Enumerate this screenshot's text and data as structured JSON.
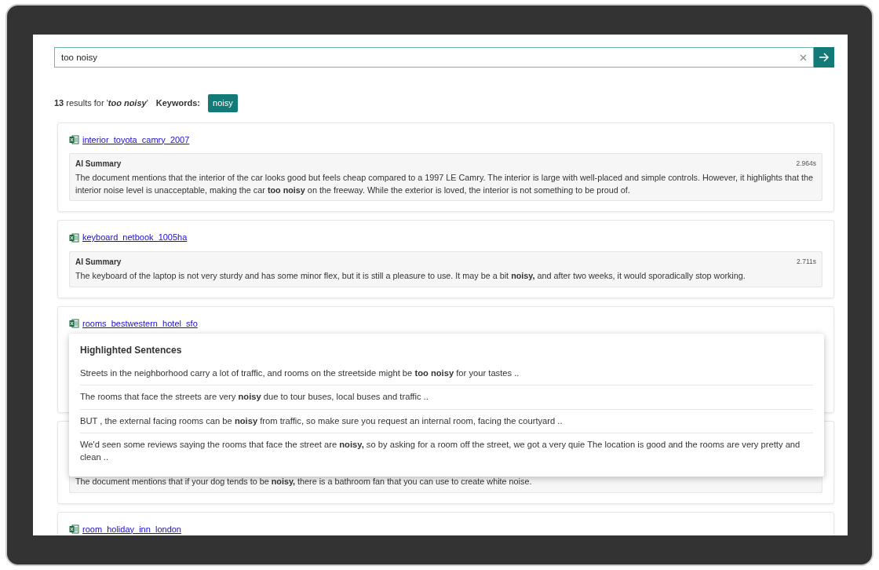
{
  "search": {
    "value": "too noisy"
  },
  "results_summary": {
    "count": "13",
    "text": "results for '",
    "query": "too noisy",
    "query_end": "'",
    "keywords_label": "Keywords:",
    "keywords": [
      "noisy"
    ]
  },
  "results": [
    {
      "file": "interior_toyota_camry_2007",
      "summary_label": "AI Summary",
      "time": "2.964s",
      "summary": "The document mentions that the interior of the car looks good but feels cheap compared to a 1997 LE Camry. The interior is large with well-placed and simple controls. However, it highlights that the interior noise level is unacceptable, making the car **too noisy** on the freeway. While the exterior is loved, the interior is not something to be proud of."
    },
    {
      "file": "keyboard_netbook_1005ha",
      "summary_label": "AI Summary",
      "time": "2.711s",
      "summary": "The keyboard of the laptop is not very sturdy and has some minor flex, but it is still a pleasure to use. It may be a bit **noisy,** and after two weeks, it would sporadically stop working."
    },
    {
      "file": "rooms_bestwestern_hotel_sfo",
      "popover": {
        "title": "Highlighted Sentences",
        "sentences": [
          "Streets in the neighborhood carry a lot of traffic, and rooms on the streetside might be **too noisy** for your tastes ..",
          "The rooms that face the streets are very **noisy** due to tour buses, local buses and traffic ..",
          "BUT , the external facing rooms can be **noisy** from traffic, so make sure you request an internal room, facing the courtyard ..",
          "We'd seen some reviews saying the rooms that face the street are **noisy,** so by asking for a room off the street, we got a very quie  The location is good and the rooms are very pretty and clean .."
        ]
      }
    },
    {
      "summary": "The document mentions that if your dog tends to be **noisy,** there is a bathroom fan that you can use to create white noise."
    },
    {
      "file": "room_holiday_inn_london"
    }
  ]
}
